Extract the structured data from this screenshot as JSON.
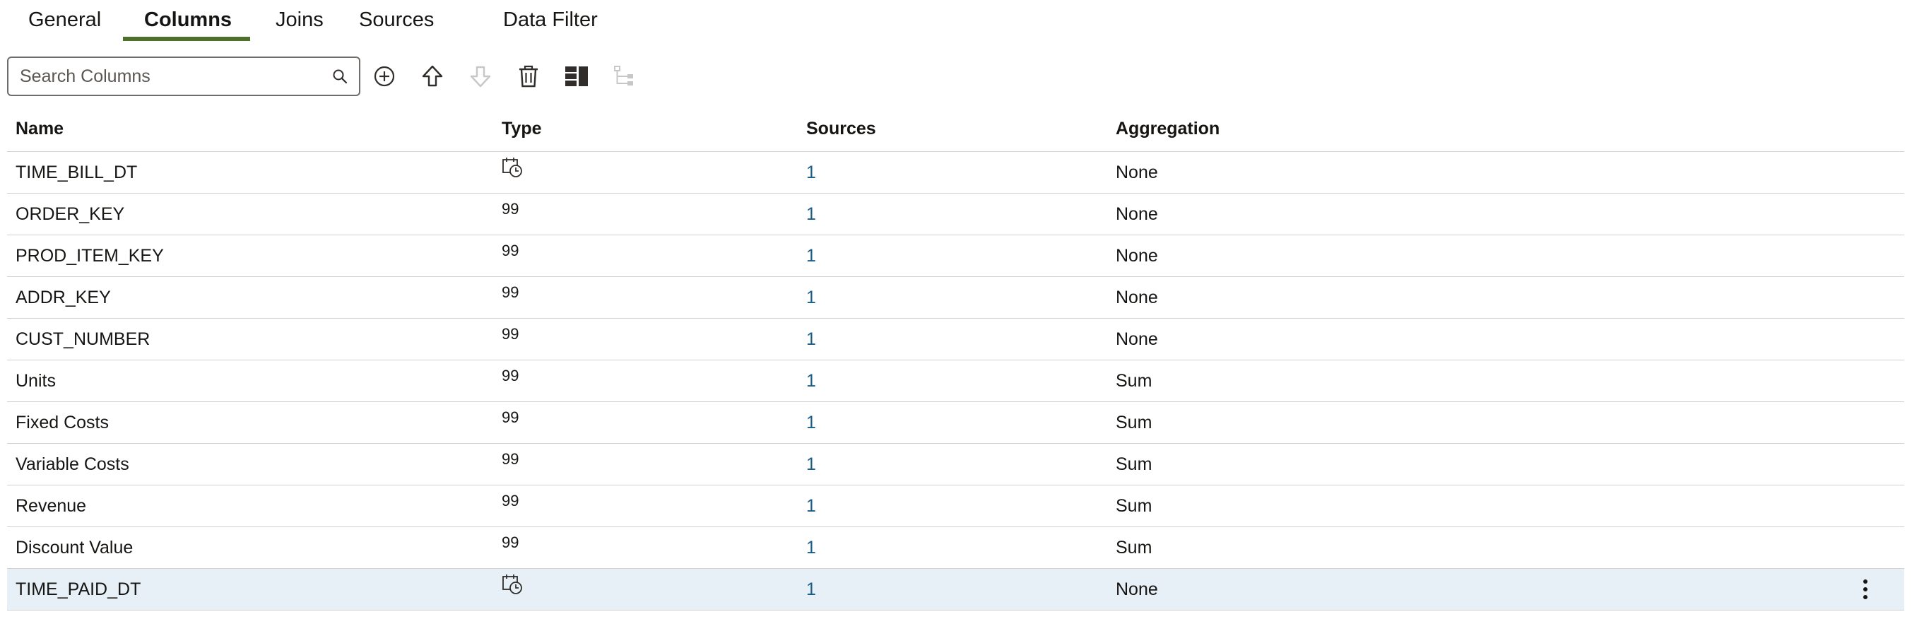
{
  "tabs": [
    {
      "label": "General",
      "active": false
    },
    {
      "label": "Columns",
      "active": true
    },
    {
      "label": "Joins",
      "active": false
    },
    {
      "label": "Sources",
      "active": false
    },
    {
      "label": "Data Filter",
      "active": false
    }
  ],
  "accent_color": "#4f6f2f",
  "toolbar": {
    "search_placeholder": "Search Columns",
    "search_icon": "magnifier-icon",
    "tools": [
      "add-circle-icon",
      "move-up-icon",
      "move-down-icon",
      "delete-icon",
      "layout-panel-icon",
      "hierarchy-icon"
    ]
  },
  "table": {
    "headers": {
      "name": "Name",
      "type": "Type",
      "sources": "Sources",
      "aggregation": "Aggregation"
    },
    "rows": [
      {
        "name": "TIME_BILL_DT",
        "type": "datetime-icon",
        "sources": "1",
        "aggregation": "None"
      },
      {
        "name": "ORDER_KEY",
        "type": "99",
        "sources": "1",
        "aggregation": "None"
      },
      {
        "name": "PROD_ITEM_KEY",
        "type": "99",
        "sources": "1",
        "aggregation": "None"
      },
      {
        "name": "ADDR_KEY",
        "type": "99",
        "sources": "1",
        "aggregation": "None"
      },
      {
        "name": "CUST_NUMBER",
        "type": "99",
        "sources": "1",
        "aggregation": "None"
      },
      {
        "name": "Units",
        "type": "99",
        "sources": "1",
        "aggregation": "Sum"
      },
      {
        "name": "Fixed Costs",
        "type": "99",
        "sources": "1",
        "aggregation": "Sum"
      },
      {
        "name": "Variable Costs",
        "type": "99",
        "sources": "1",
        "aggregation": "Sum"
      },
      {
        "name": "Revenue",
        "type": "99",
        "sources": "1",
        "aggregation": "Sum"
      },
      {
        "name": "Discount Value",
        "type": "99",
        "sources": "1",
        "aggregation": "Sum"
      },
      {
        "name": "TIME_PAID_DT",
        "type": "datetime-icon",
        "sources": "1",
        "aggregation": "None"
      }
    ],
    "selected_row_menu_icon": "more-vertical-icon"
  }
}
